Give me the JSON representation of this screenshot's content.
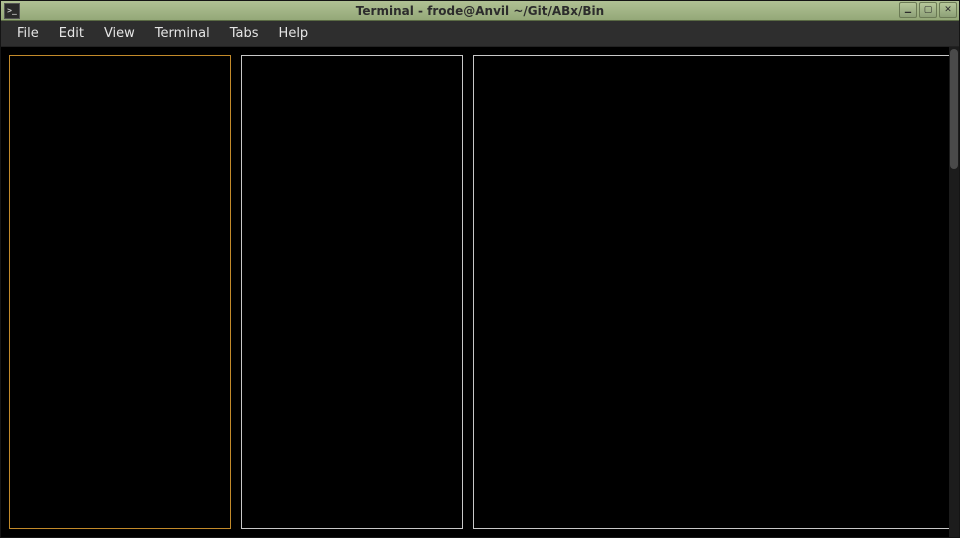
{
  "titlebar": {
    "title": "Terminal - frode@Anvil ~/Git/ABx/Bin"
  },
  "menubar": {
    "items": [
      {
        "label": "File"
      },
      {
        "label": "Edit"
      },
      {
        "label": "View"
      },
      {
        "label": "Terminal"
      },
      {
        "label": "Tabs"
      },
      {
        "label": "Help"
      }
    ]
  },
  "colors": {
    "titlebar_bg_top": "#b0c194",
    "titlebar_bg_bottom": "#94a878",
    "terminal_bg": "#000000",
    "pane_border": "#c8c8c8",
    "pane_active_border": "#c28a2a"
  },
  "panes": {
    "count": 3,
    "active_index": 0
  }
}
